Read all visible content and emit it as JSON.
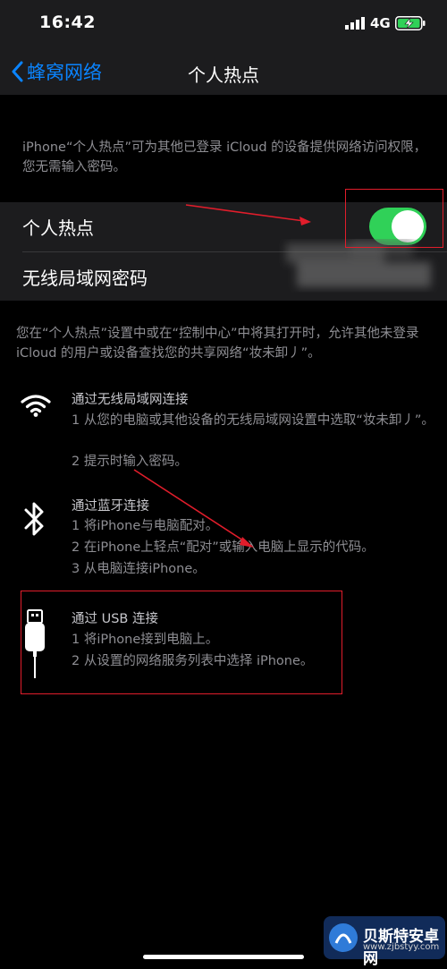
{
  "status_bar": {
    "time": "16:42",
    "network": "4G"
  },
  "nav": {
    "back_label": "蜂窝网络",
    "title": "个人热点"
  },
  "intro_text": "iPhone“个人热点”可为其他已登录 iCloud 的设备提供网络访问权限，您无需输入密码。",
  "settings": {
    "hotspot_label": "个人热点",
    "hotspot_enabled": true,
    "wifi_password_label": "无线局域网密码"
  },
  "discover_text": "您在“个人热点”设置中或在“控制中心”中将其打开时，允许其他未登录 iCloud 的用户或设备查找您的共享网络“妆未卸丿”。",
  "connections": [
    {
      "icon": "wifi-icon",
      "title": "通过无线局域网连接",
      "steps": [
        "1 从您的电脑或其他设备的无线局域网设置中选取“妆未卸丿”。",
        "2 提示时输入密码。"
      ]
    },
    {
      "icon": "bluetooth-icon",
      "title": "通过蓝牙连接",
      "steps": [
        "1 将iPhone与电脑配对。",
        "2 在iPhone上轻点“配对”或输入电脑上显示的代码。",
        "3 从电脑连接iPhone。"
      ]
    },
    {
      "icon": "usb-cable-icon",
      "title": "通过 USB 连接",
      "steps": [
        "1 将iPhone接到电脑上。",
        "2 从设置的网络服务列表中选择 iPhone。"
      ]
    }
  ],
  "watermark": {
    "name": "贝斯特安卓网",
    "url": "www.zjbstyy.com"
  },
  "colors": {
    "accent": "#0a84ff",
    "toggle_on": "#30d158",
    "annotation": "#e11d2b",
    "cell_bg": "#1c1c1e"
  }
}
